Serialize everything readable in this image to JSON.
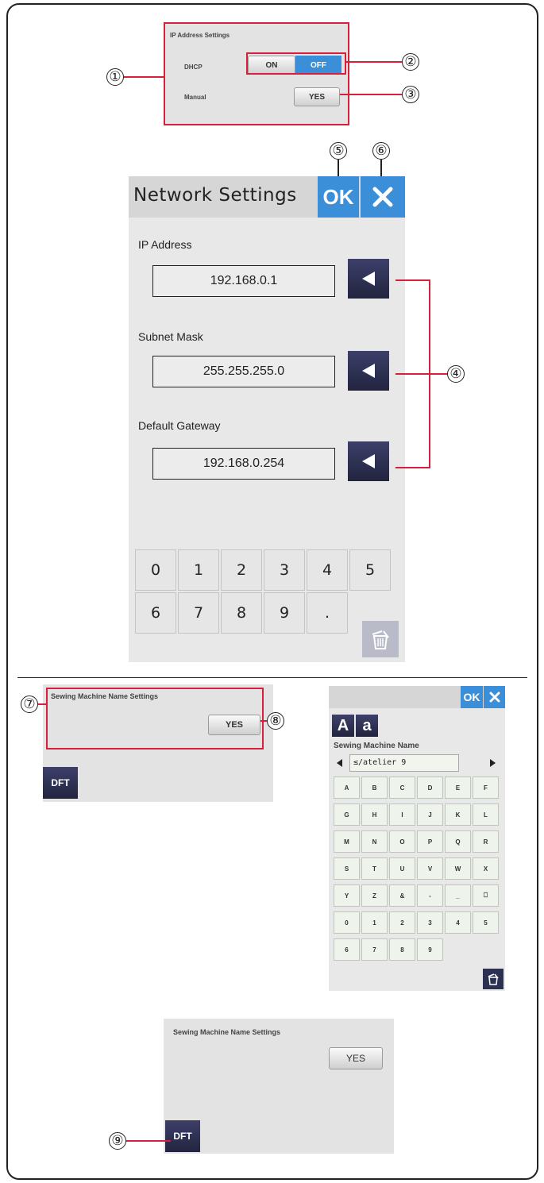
{
  "ip_panel": {
    "title": "IP Address Settings",
    "dhcp_label": "DHCP",
    "on_label": "ON",
    "off_label": "OFF",
    "manual_label": "Manual",
    "yes_label": "YES"
  },
  "network": {
    "title": "Network Settings",
    "ok_label": "OK",
    "ip_label": "IP Address",
    "ip_value": "192.168.0.1",
    "subnet_label": "Subnet Mask",
    "subnet_value": "255.255.255.0",
    "gateway_label": "Default Gateway",
    "gateway_value": "192.168.0.254",
    "keys": [
      "0",
      "1",
      "2",
      "3",
      "4",
      "5",
      "6",
      "7",
      "8",
      "9",
      "."
    ]
  },
  "name_panel": {
    "title": "Sewing Machine Name Settings",
    "yes_label": "YES",
    "dft_label": "DFT"
  },
  "keyboard": {
    "ok_label": "OK",
    "upper_label": "A",
    "lower_label": "a",
    "title": "Sewing Machine Name",
    "value": "≤/atelier 9",
    "keys": [
      "A",
      "B",
      "C",
      "D",
      "E",
      "F",
      "G",
      "H",
      "I",
      "J",
      "K",
      "L",
      "M",
      "N",
      "O",
      "P",
      "Q",
      "R",
      "S",
      "T",
      "U",
      "V",
      "W",
      "X",
      "Y",
      "Z",
      "&",
      "-",
      "_",
      "⎕",
      "0",
      "1",
      "2",
      "3",
      "4",
      "5",
      "6",
      "7",
      "8",
      "9"
    ]
  },
  "name_panel2": {
    "title": "Sewing Machine Name Settings",
    "yes_label": "YES",
    "dft_label": "DFT"
  },
  "callouts": [
    "①",
    "②",
    "③",
    "④",
    "⑤",
    "⑥",
    "⑦",
    "⑧",
    "⑨"
  ]
}
